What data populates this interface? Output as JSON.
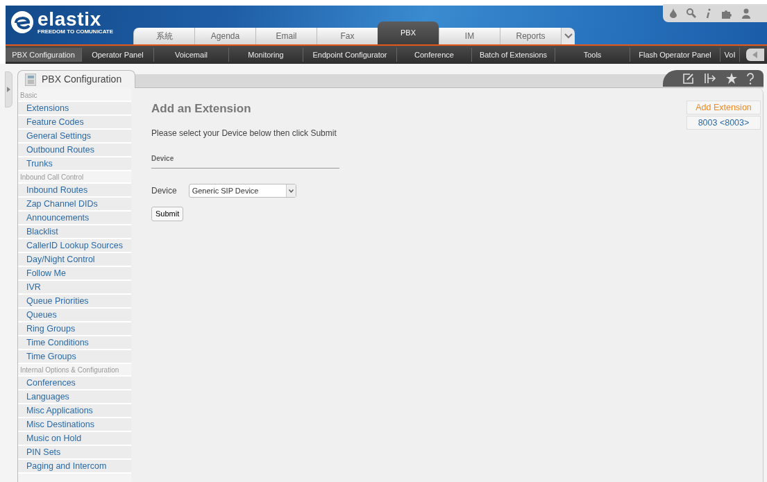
{
  "logo": {
    "name": "elastix",
    "tagline": "FREEDOM TO COMUNICATE"
  },
  "tabs": [
    {
      "label": "系統",
      "selected": false
    },
    {
      "label": "Agenda",
      "selected": false
    },
    {
      "label": "Email",
      "selected": false
    },
    {
      "label": "Fax",
      "selected": false
    },
    {
      "label": "PBX",
      "selected": true
    },
    {
      "label": "IM",
      "selected": false
    },
    {
      "label": "Reports",
      "selected": false
    }
  ],
  "menu": [
    {
      "label": "PBX Configuration",
      "selected": true
    },
    {
      "label": "Operator Panel",
      "selected": false
    },
    {
      "label": "Voicemail",
      "selected": false
    },
    {
      "label": "Monitoring",
      "selected": false
    },
    {
      "label": "Endpoint Configurator",
      "selected": false
    },
    {
      "label": "Conference",
      "selected": false
    },
    {
      "label": "Batch of Extensions",
      "selected": false
    },
    {
      "label": "Tools",
      "selected": false
    },
    {
      "label": "Flash Operator Panel",
      "selected": false
    },
    {
      "label": "VoI",
      "selected": false
    }
  ],
  "panel_tab": {
    "title": "PBX Configuration"
  },
  "sidebar": [
    {
      "kind": "group",
      "label": "Basic"
    },
    {
      "kind": "link",
      "label": "Extensions"
    },
    {
      "kind": "link",
      "label": "Feature Codes"
    },
    {
      "kind": "link",
      "label": "General Settings"
    },
    {
      "kind": "link",
      "label": "Outbound Routes"
    },
    {
      "kind": "link",
      "label": "Trunks"
    },
    {
      "kind": "group",
      "label": "Inbound Call Control"
    },
    {
      "kind": "link",
      "label": "Inbound Routes"
    },
    {
      "kind": "link",
      "label": "Zap Channel DIDs"
    },
    {
      "kind": "link",
      "label": "Announcements"
    },
    {
      "kind": "link",
      "label": "Blacklist"
    },
    {
      "kind": "link",
      "label": "CallerID Lookup Sources"
    },
    {
      "kind": "link",
      "label": "Day/Night Control"
    },
    {
      "kind": "link",
      "label": "Follow Me"
    },
    {
      "kind": "link",
      "label": "IVR"
    },
    {
      "kind": "link",
      "label": "Queue Priorities"
    },
    {
      "kind": "link",
      "label": "Queues"
    },
    {
      "kind": "link",
      "label": "Ring Groups"
    },
    {
      "kind": "link",
      "label": "Time Conditions"
    },
    {
      "kind": "link",
      "label": "Time Groups"
    },
    {
      "kind": "group",
      "label": "Internal Options & Configuration"
    },
    {
      "kind": "link",
      "label": "Conferences"
    },
    {
      "kind": "link",
      "label": "Languages"
    },
    {
      "kind": "link",
      "label": "Misc Applications"
    },
    {
      "kind": "link",
      "label": "Misc Destinations"
    },
    {
      "kind": "link",
      "label": "Music on Hold"
    },
    {
      "kind": "link",
      "label": "PIN Sets"
    },
    {
      "kind": "link",
      "label": "Paging and Intercom"
    }
  ],
  "content": {
    "heading": "Add an Extension",
    "instruction": "Please select your Device below then click Submit",
    "section": "Device",
    "field_label": "Device",
    "device_value": "Generic SIP Device",
    "submit": "Submit"
  },
  "right_list": [
    {
      "label": "Add Extension",
      "selected": true
    },
    {
      "label": "8003 <8003>",
      "selected": false
    }
  ]
}
